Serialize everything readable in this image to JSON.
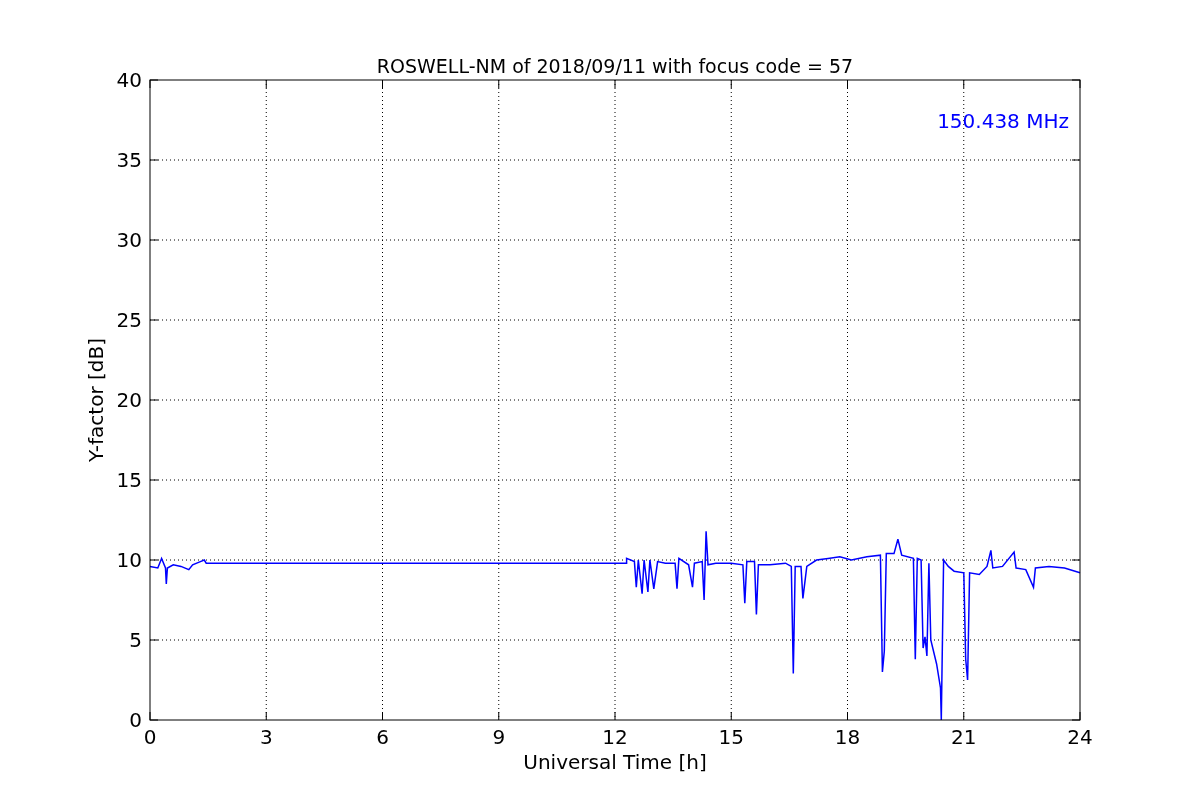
{
  "figure": {
    "chart_data": {
      "type": "line",
      "title": "ROSWELL-NM of 2018/09/11 with focus code = 57",
      "xlabel": "Universal Time [h]",
      "ylabel": "Y-factor [dB]",
      "x": [
        0,
        0.2,
        0.3,
        0.4,
        0.42,
        0.45,
        0.6,
        0.8,
        1.0,
        1.1,
        1.3,
        1.4,
        1.45,
        12.3,
        12.3,
        12.5,
        12.55,
        12.6,
        12.7,
        12.75,
        12.85,
        12.9,
        13.0,
        13.1,
        13.3,
        13.55,
        13.6,
        13.65,
        13.9,
        14.0,
        14.05,
        14.25,
        14.3,
        14.35,
        14.4,
        14.6,
        15.0,
        15.3,
        15.35,
        15.4,
        15.6,
        15.65,
        15.7,
        16.0,
        16.4,
        16.55,
        16.6,
        16.65,
        16.8,
        16.85,
        16.95,
        17.2,
        17.5,
        17.8,
        18.1,
        18.5,
        18.85,
        18.9,
        18.95,
        19.0,
        19.2,
        19.3,
        19.4,
        19.7,
        19.75,
        19.8,
        19.9,
        19.95,
        20.0,
        20.05,
        20.1,
        20.15,
        20.3,
        20.4,
        20.42,
        20.48,
        20.6,
        20.75,
        21.0,
        21.05,
        21.1,
        21.15,
        21.4,
        21.6,
        21.7,
        21.75,
        22.0,
        22.3,
        22.35,
        22.6,
        22.8,
        22.85,
        23.2,
        23.6,
        24.0
      ],
      "series": [
        {
          "name": "150.438 MHz",
          "color": "#0000ff",
          "values": [
            9.6,
            9.5,
            10.1,
            9.5,
            8.5,
            9.5,
            9.7,
            9.6,
            9.4,
            9.7,
            9.9,
            10.0,
            9.8,
            9.8,
            10.1,
            9.9,
            8.3,
            10.0,
            7.9,
            10.0,
            8.0,
            10.0,
            8.2,
            9.9,
            9.8,
            9.8,
            8.2,
            10.1,
            9.7,
            8.3,
            9.8,
            9.9,
            7.5,
            11.8,
            9.7,
            9.8,
            9.8,
            9.7,
            7.3,
            9.9,
            9.9,
            6.6,
            9.7,
            9.7,
            9.8,
            9.6,
            2.9,
            9.6,
            9.6,
            7.6,
            9.6,
            10.0,
            10.1,
            10.2,
            10.0,
            10.2,
            10.3,
            3.0,
            4.3,
            10.4,
            10.4,
            11.3,
            10.3,
            10.1,
            3.8,
            10.1,
            10.0,
            4.5,
            5.2,
            4.0,
            9.8,
            5.0,
            3.5,
            2.0,
            0,
            10.0,
            9.6,
            9.3,
            9.2,
            3.8,
            2.5,
            9.2,
            9.1,
            9.6,
            10.6,
            9.5,
            9.6,
            10.5,
            9.5,
            9.4,
            8.3,
            9.5,
            9.6,
            9.5,
            9.2
          ]
        }
      ],
      "xlim": [
        0,
        24
      ],
      "ylim": [
        0,
        40
      ],
      "xticks": [
        0,
        3,
        6,
        9,
        12,
        15,
        18,
        21,
        24
      ],
      "yticks": [
        0,
        5,
        10,
        15,
        20,
        25,
        30,
        35,
        40
      ],
      "grid": true
    }
  }
}
